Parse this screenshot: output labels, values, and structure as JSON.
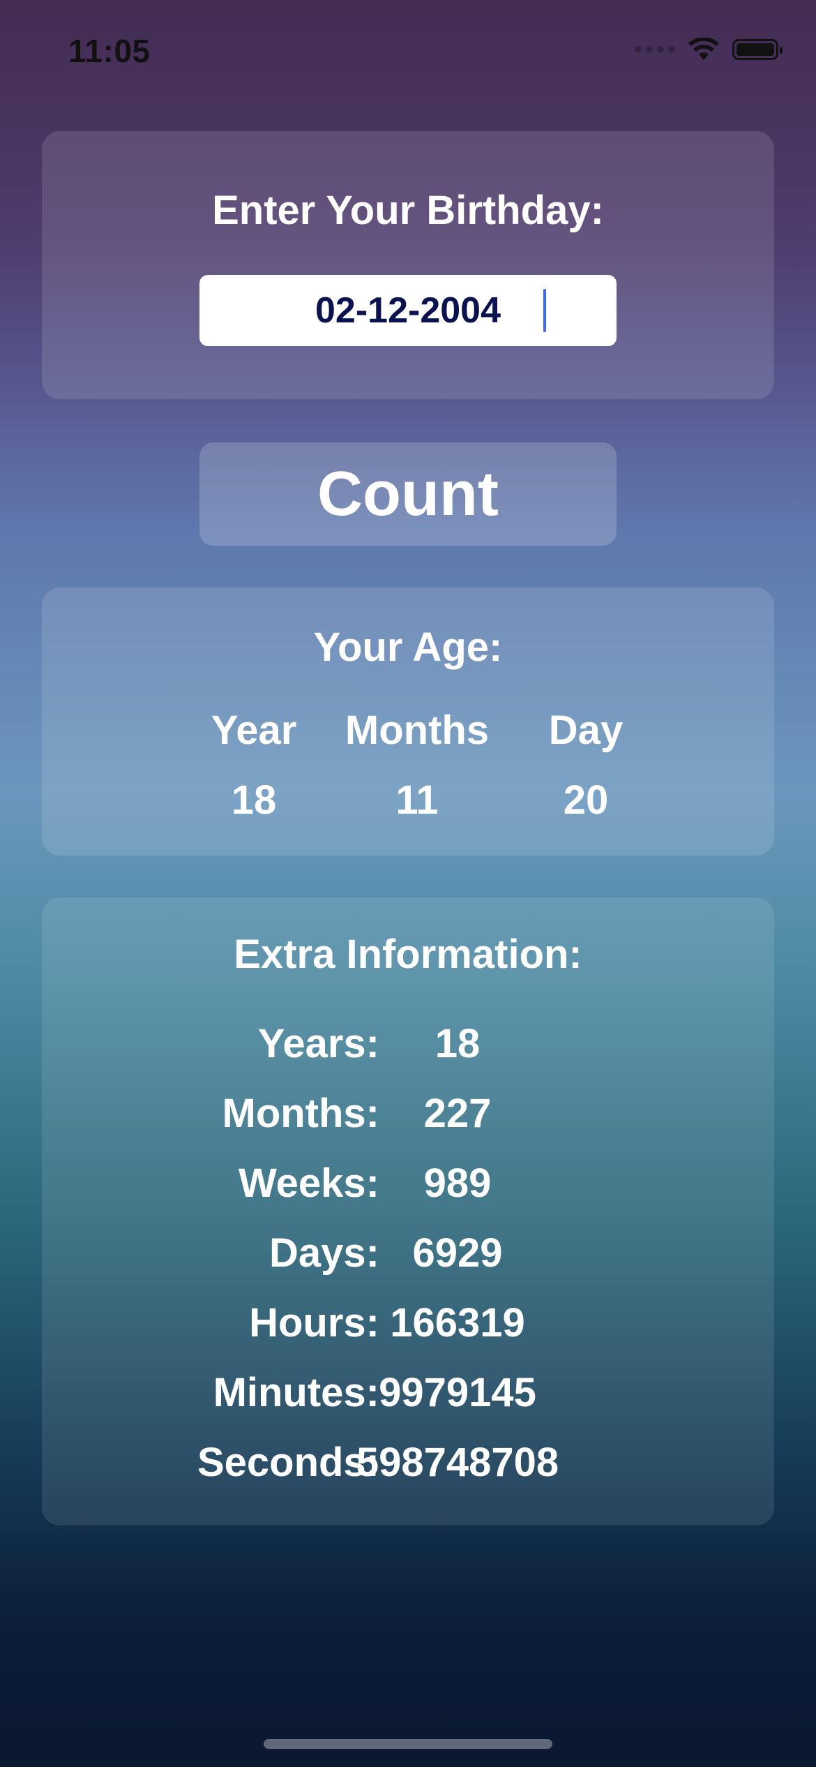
{
  "status_bar": {
    "time": "11:05",
    "wifi_icon": "wifi-icon",
    "battery_icon": "battery-icon"
  },
  "birthday": {
    "title": "Enter Your Birthday:",
    "input_value": "02-12-2004"
  },
  "count_button": {
    "label": "Count"
  },
  "age": {
    "title": "Your Age:",
    "columns": [
      {
        "label": "Year",
        "value": "18"
      },
      {
        "label": "Months",
        "value": "11"
      },
      {
        "label": "Day",
        "value": "20"
      }
    ]
  },
  "extra": {
    "title": "Extra Information:",
    "rows": [
      {
        "label": "Years:",
        "value": "18"
      },
      {
        "label": "Months:",
        "value": "227"
      },
      {
        "label": "Weeks:",
        "value": "989"
      },
      {
        "label": "Days:",
        "value": "6929"
      },
      {
        "label": "Hours:",
        "value": "166319"
      },
      {
        "label": "Minutes:",
        "value": "9979145"
      },
      {
        "label": "Seconds:",
        "value": "598748708"
      }
    ]
  },
  "colors": {
    "accent_caret": "#3b6cf0",
    "input_text": "#0b1250",
    "background_top": "#432b52",
    "background_mid": "#6a97bd",
    "background_bottom": "#0a1730"
  }
}
